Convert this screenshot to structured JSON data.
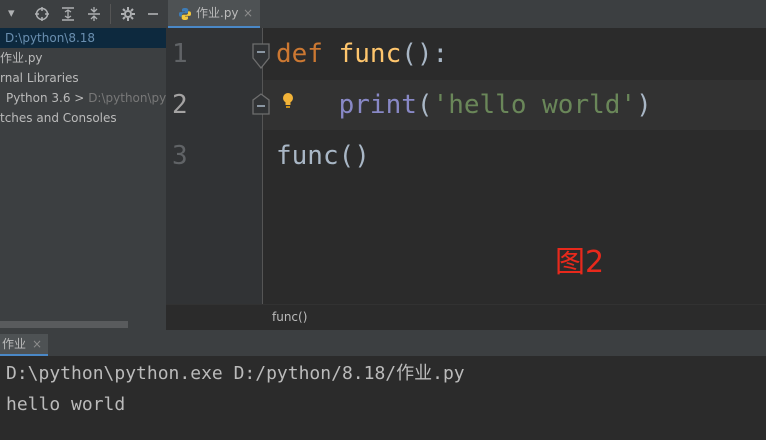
{
  "project": {
    "rows": [
      {
        "label": "D:\\python\\8.18",
        "selected": true
      },
      {
        "label": "作业.py"
      },
      {
        "label": "rnal Libraries"
      },
      {
        "label": "Python 3.6 > ",
        "hint": "D:\\python\\pyth"
      },
      {
        "label": "tches and Consoles"
      }
    ]
  },
  "editor": {
    "tab_label": "作业.py",
    "tab_close": "×",
    "line_numbers": [
      "1",
      "2",
      "3"
    ],
    "lines": [
      {
        "tokens": [
          {
            "text": "def",
            "cls": "kw"
          },
          {
            "text": " "
          },
          {
            "text": "func",
            "cls": "fn"
          },
          {
            "text": "():"
          }
        ]
      },
      {
        "tokens": [
          {
            "text": "    "
          },
          {
            "text": "print",
            "cls": "bi"
          },
          {
            "text": "("
          },
          {
            "text": "'hello world'",
            "cls": "str"
          },
          {
            "text": ")"
          }
        ]
      },
      {
        "tokens": [
          {
            "text": "func()"
          }
        ]
      }
    ],
    "breadcrumb": "func()",
    "annotation": "图2"
  },
  "run": {
    "tab_label": "作业",
    "tab_close": "×",
    "output": [
      "D:\\python\\python.exe D:/python/8.18/作业.py",
      "hello world"
    ]
  },
  "colors": {
    "accent": "#4a88c7",
    "annotation": "#e8291c"
  }
}
